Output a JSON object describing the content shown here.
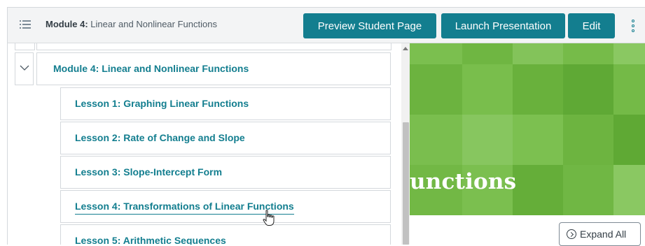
{
  "header": {
    "breadcrumb_prefix": "Module 4:",
    "breadcrumb_title": "Linear and Nonlinear Functions",
    "preview_label": "Preview Student Page",
    "launch_label": "Launch Presentation",
    "edit_label": "Edit",
    "accent_color": "#137e8f"
  },
  "outline": {
    "module_label": "Module 4: Linear and Nonlinear Functions",
    "lessons": [
      {
        "label": "Lesson 1: Graphing Linear Functions"
      },
      {
        "label": "Lesson 2: Rate of Change and Slope"
      },
      {
        "label": "Lesson 3: Slope-Intercept Form"
      },
      {
        "label": "Lesson 4: Transformations of Linear Functions",
        "hovered": true
      },
      {
        "label": "Lesson 5: Arithmetic Sequences"
      }
    ]
  },
  "banner": {
    "title_fragment": "unctions",
    "color": "#72b845"
  },
  "expand_all_label": "Expand All",
  "icons": {
    "menu": "outline-list-icon",
    "more": "vertical-dots-icon",
    "collapse": "chevron-down-icon",
    "expand": "chevron-circle-right-icon",
    "pointer": "hand-pointer-icon"
  }
}
